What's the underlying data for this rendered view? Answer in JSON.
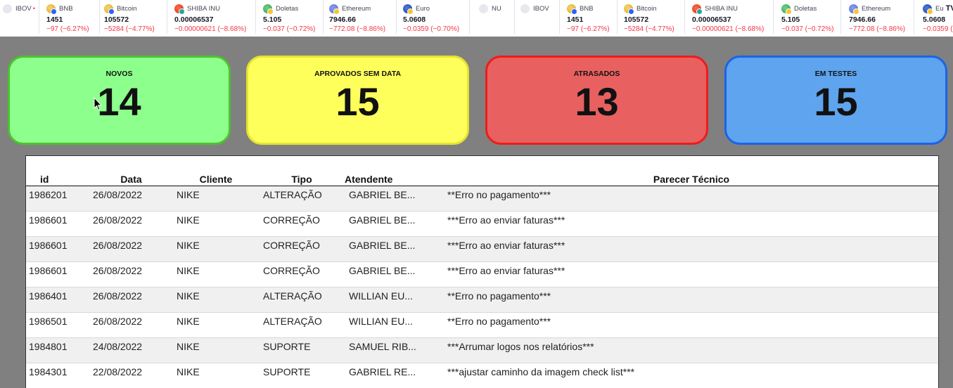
{
  "ticker": {
    "items": [
      {
        "name": "IBOV",
        "type": "single",
        "icon": "ibov-icon",
        "dot": "•"
      },
      {
        "name": "BNB",
        "icon": "bnb-coin-icon",
        "price": "1451",
        "change": "−97 (−6.27%)"
      },
      {
        "name": "Bitcoin",
        "icon": "bitcoin-coin-icon",
        "price": "105572",
        "change": "−5284 (−4.77%)"
      },
      {
        "name": "SHIBA INU",
        "icon": "shiba-inu-coin-icon",
        "price": "0.00006537",
        "change": "−0.00000621 (−8.68%)"
      },
      {
        "name": "Doletas",
        "icon": "doletas-coin-icon",
        "price": "5.105",
        "change": "−0.037 (−0.72%)"
      },
      {
        "name": "Ethereum",
        "icon": "ethereum-coin-icon",
        "price": "7946.66",
        "change": "−772.08 (−8.86%)"
      },
      {
        "name": "Euro",
        "icon": "euro-coin-icon",
        "price": "5.0608",
        "change": "−0.0359 (−0.70%)"
      },
      {
        "name": "NU",
        "type": "single",
        "icon": "nu-icon"
      },
      {
        "name": "IBOV",
        "type": "single",
        "icon": "ibov-icon"
      },
      {
        "name": "BNB",
        "icon": "bnb-coin-icon",
        "price": "1451",
        "change": "−97 (−6.27%)"
      },
      {
        "name": "Bitcoin",
        "icon": "bitcoin-coin-icon",
        "price": "105572",
        "change": "−5284 (−4.77%)"
      },
      {
        "name": "SHIBA INU",
        "icon": "shiba-inu-coin-icon",
        "price": "0.00006537",
        "change": "−0.00000621 (−8.68%)"
      },
      {
        "name": "Doletas",
        "icon": "doletas-coin-icon",
        "price": "5.105",
        "change": "−0.037 (−0.72%)"
      },
      {
        "name": "Ethereum",
        "icon": "ethereum-coin-icon",
        "price": "7946.66",
        "change": "−772.08 (−8.86%)"
      },
      {
        "name": "Eu",
        "icon": "euro-coin-icon",
        "price": "5.0608",
        "change": "−0.0359 (−",
        "logo": "TV"
      }
    ]
  },
  "cards": {
    "novos": {
      "label": "NOVOS",
      "value": "14",
      "color": "#8cff8c"
    },
    "aprovados": {
      "label": "APROVADOS SEM DATA",
      "value": "15",
      "color": "#ffff5c"
    },
    "atrasados": {
      "label": "ATRASADOS",
      "value": "13",
      "color": "#e86060"
    },
    "testes": {
      "label": "EM TESTES",
      "value": "15",
      "color": "#5ea4ee"
    }
  },
  "table": {
    "headers": {
      "id": "id",
      "data": "Data",
      "cliente": "Cliente",
      "tipo": "Tipo",
      "atendente": "Atendente",
      "parecer": "Parecer Técnico"
    },
    "rows": [
      {
        "id": "1986201",
        "data": "26/08/2022",
        "cliente": "NIKE",
        "tipo": "ALTERAÇÃO",
        "atendente": "GABRIEL BE...",
        "parecer": "**Erro no pagamento***"
      },
      {
        "id": "1986601",
        "data": "26/08/2022",
        "cliente": "NIKE",
        "tipo": "CORREÇÃO",
        "atendente": "GABRIEL BE...",
        "parecer": "***Erro ao enviar faturas***"
      },
      {
        "id": "1986601",
        "data": "26/08/2022",
        "cliente": "NIKE",
        "tipo": "CORREÇÃO",
        "atendente": "GABRIEL BE...",
        "parecer": "***Erro ao enviar faturas***"
      },
      {
        "id": "1986601",
        "data": "26/08/2022",
        "cliente": "NIKE",
        "tipo": "CORREÇÃO",
        "atendente": "GABRIEL BE...",
        "parecer": "***Erro ao enviar faturas***"
      },
      {
        "id": "1986401",
        "data": "26/08/2022",
        "cliente": "NIKE",
        "tipo": "ALTERAÇÃO",
        "atendente": "WILLIAN EU...",
        "parecer": "**Erro no pagamento***"
      },
      {
        "id": "1986501",
        "data": "26/08/2022",
        "cliente": "NIKE",
        "tipo": "ALTERAÇÃO",
        "atendente": "WILLIAN EU...",
        "parecer": "**Erro no pagamento***"
      },
      {
        "id": "1984801",
        "data": "24/08/2022",
        "cliente": "NIKE",
        "tipo": "SUPORTE",
        "atendente": "SAMUEL RIB...",
        "parecer": "***Arrumar logos nos relatórios***"
      },
      {
        "id": "1984301",
        "data": "22/08/2022",
        "cliente": "NIKE",
        "tipo": "SUPORTE",
        "atendente": "GABRIEL RE...",
        "parecer": "***ajustar caminho da imagem check list***"
      }
    ]
  }
}
